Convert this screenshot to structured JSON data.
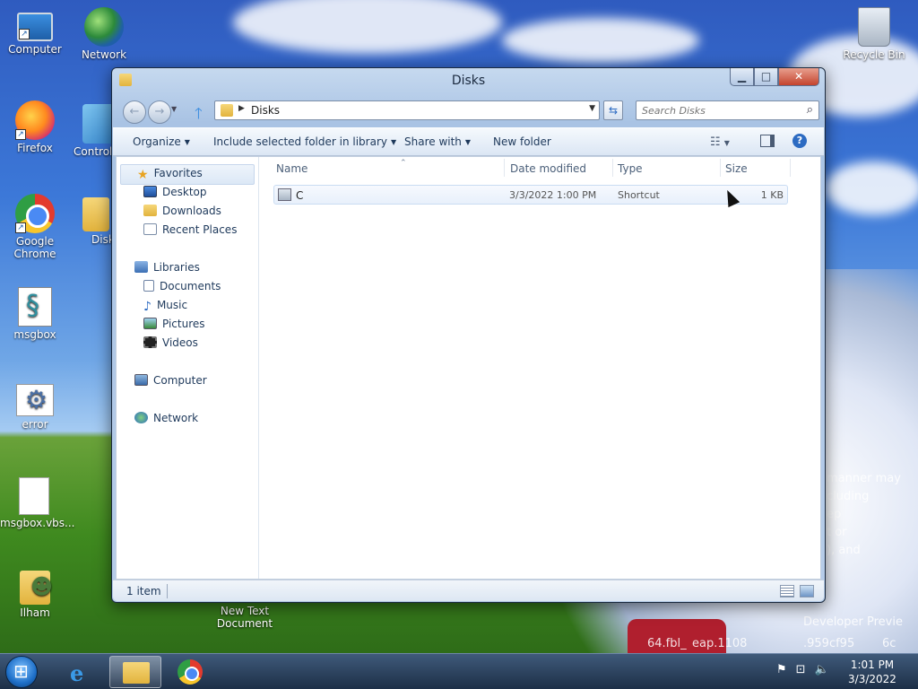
{
  "desktop": {
    "icons": {
      "computer": "Computer",
      "network": "Network",
      "firefox": "Firefox",
      "control_panel": "Control",
      "chrome_line1": "Google",
      "chrome_line2": "Chrome",
      "disks": "Disk",
      "msgbox": "msgbox",
      "error": "error",
      "msgbox_vbs": "msgbox.vbs...",
      "ilham": "Ilham",
      "new_text_line1": "New Text",
      "new_text_line2": "Document",
      "recycle_bin": "Recycle Bin"
    },
    "overlay_text": [
      "manner may",
      "cluding",
      "ep",
      "t or",
      "), and",
      "Developer Previe",
      "64.fbl_",
      "eap.1108",
      ".959cf95",
      "6c"
    ]
  },
  "window": {
    "title": "Disks",
    "address": {
      "path": "Disks"
    },
    "search": {
      "placeholder": "Search Disks"
    },
    "toolbar": {
      "organize": "Organize",
      "include_library": "Include selected folder in library",
      "share_with": "Share with",
      "new_folder": "New folder"
    },
    "nav": {
      "favorites": "Favorites",
      "desktop": "Desktop",
      "downloads": "Downloads",
      "recent_places": "Recent Places",
      "libraries": "Libraries",
      "documents": "Documents",
      "music": "Music",
      "pictures": "Pictures",
      "videos": "Videos",
      "computer": "Computer",
      "network": "Network"
    },
    "columns": {
      "name": "Name",
      "date_modified": "Date modified",
      "type": "Type",
      "size": "Size"
    },
    "files": [
      {
        "name": "C",
        "date_modified": "3/3/2022 1:00 PM",
        "type": "Shortcut",
        "size": "1 KB"
      }
    ],
    "status": {
      "item_count": "1 item"
    }
  },
  "taskbar": {
    "clock_time": "1:01 PM",
    "clock_date": "3/3/2022"
  }
}
